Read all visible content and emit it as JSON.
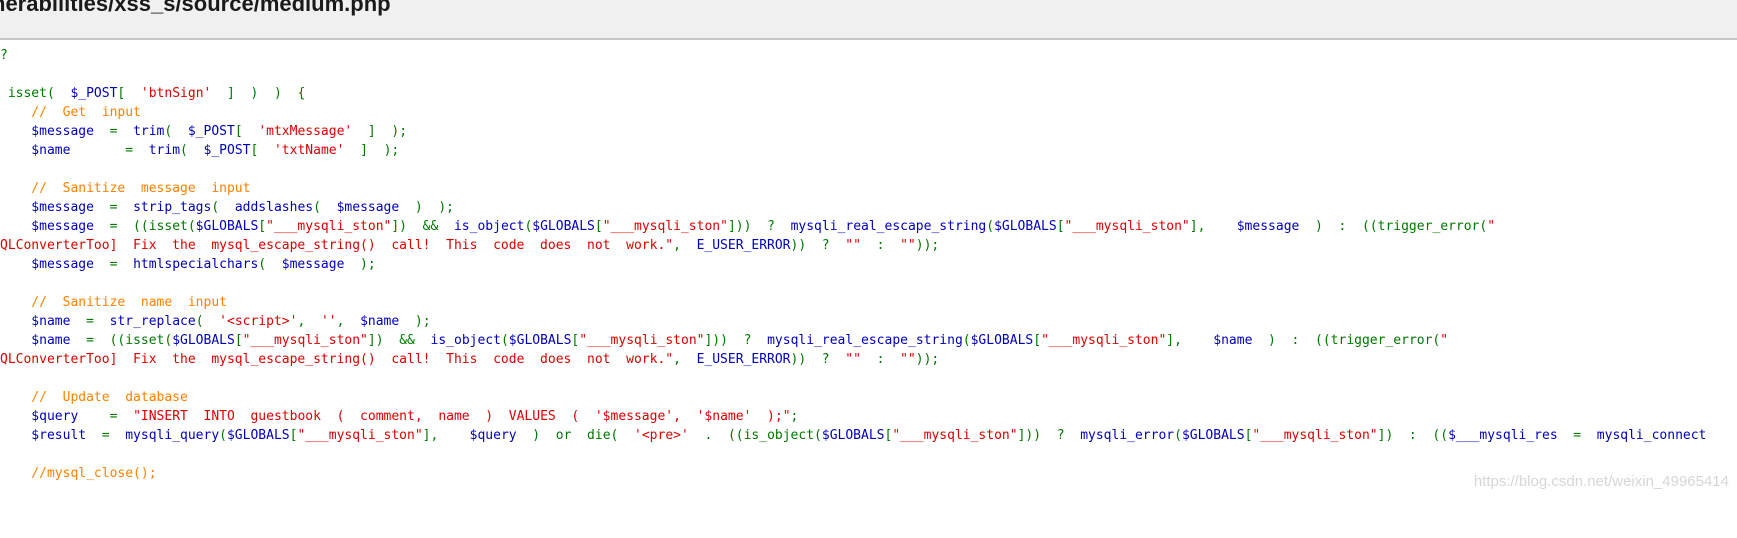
{
  "title": "nerabilities/xss_s/source/medium.php",
  "colors": {
    "default": "#0000BB",
    "keyword": "#007700",
    "string": "#DD0000",
    "comment": "#FF8000"
  },
  "code_lines": [
    [
      [
        "keyword",
        "?"
      ]
    ],
    [],
    [
      [
        "keyword",
        " isset(  "
      ],
      [
        "default",
        "$_POST"
      ],
      [
        "keyword",
        "[  "
      ],
      [
        "string",
        "'btnSign'"
      ],
      [
        "keyword",
        "  ]  )  )  {"
      ]
    ],
    [
      [
        "comment",
        "    //  Get  input"
      ]
    ],
    [
      [
        "default",
        "    $message"
      ],
      [
        "keyword",
        "  =  "
      ],
      [
        "default",
        "trim"
      ],
      [
        "keyword",
        "(  "
      ],
      [
        "default",
        "$_POST"
      ],
      [
        "keyword",
        "[  "
      ],
      [
        "string",
        "'mtxMessage'"
      ],
      [
        "keyword",
        "  ]  );"
      ]
    ],
    [
      [
        "default",
        "    $name"
      ],
      [
        "keyword",
        "       =  "
      ],
      [
        "default",
        "trim"
      ],
      [
        "keyword",
        "(  "
      ],
      [
        "default",
        "$_POST"
      ],
      [
        "keyword",
        "[  "
      ],
      [
        "string",
        "'txtName'"
      ],
      [
        "keyword",
        "  ]  );"
      ]
    ],
    [],
    [
      [
        "comment",
        "    //  Sanitize  message  input"
      ]
    ],
    [
      [
        "default",
        "    $message"
      ],
      [
        "keyword",
        "  =  "
      ],
      [
        "default",
        "strip_tags"
      ],
      [
        "keyword",
        "(  "
      ],
      [
        "default",
        "addslashes"
      ],
      [
        "keyword",
        "(  "
      ],
      [
        "default",
        "$message"
      ],
      [
        "keyword",
        "  )  );"
      ]
    ],
    [
      [
        "default",
        "    $message"
      ],
      [
        "keyword",
        "  =  ((isset("
      ],
      [
        "default",
        "$GLOBALS"
      ],
      [
        "keyword",
        "["
      ],
      [
        "string",
        "\"___mysqli_ston\""
      ],
      [
        "keyword",
        "])  &&  "
      ],
      [
        "default",
        "is_object"
      ],
      [
        "keyword",
        "("
      ],
      [
        "default",
        "$GLOBALS"
      ],
      [
        "keyword",
        "["
      ],
      [
        "string",
        "\"___mysqli_ston\""
      ],
      [
        "keyword",
        "]))  ?  "
      ],
      [
        "default",
        "mysqli_real_escape_string"
      ],
      [
        "keyword",
        "("
      ],
      [
        "default",
        "$GLOBALS"
      ],
      [
        "keyword",
        "["
      ],
      [
        "string",
        "\"___mysqli_ston\""
      ],
      [
        "keyword",
        "],    "
      ],
      [
        "default",
        "$message"
      ],
      [
        "keyword",
        "  )  :  ((trigger_error("
      ],
      [
        "string",
        "\""
      ]
    ],
    [
      [
        "string",
        "QLConverterToo]  Fix  the  mysql_escape_string()  call!  This  code  does  not  work.\""
      ],
      [
        "keyword",
        ",  "
      ],
      [
        "default",
        "E_USER_ERROR"
      ],
      [
        "keyword",
        "))  ?  "
      ],
      [
        "string",
        "\"\""
      ],
      [
        "keyword",
        "  :  "
      ],
      [
        "string",
        "\"\""
      ],
      [
        "keyword",
        "));"
      ]
    ],
    [
      [
        "default",
        "    $message"
      ],
      [
        "keyword",
        "  =  "
      ],
      [
        "default",
        "htmlspecialchars"
      ],
      [
        "keyword",
        "(  "
      ],
      [
        "default",
        "$message"
      ],
      [
        "keyword",
        "  );"
      ]
    ],
    [],
    [
      [
        "comment",
        "    //  Sanitize  name  input"
      ]
    ],
    [
      [
        "default",
        "    $name"
      ],
      [
        "keyword",
        "  =  "
      ],
      [
        "default",
        "str_replace"
      ],
      [
        "keyword",
        "(  "
      ],
      [
        "string",
        "'<script>'"
      ],
      [
        "keyword",
        ",  "
      ],
      [
        "string",
        "''"
      ],
      [
        "keyword",
        ",  "
      ],
      [
        "default",
        "$name"
      ],
      [
        "keyword",
        "  );"
      ]
    ],
    [
      [
        "default",
        "    $name"
      ],
      [
        "keyword",
        "  =  ((isset("
      ],
      [
        "default",
        "$GLOBALS"
      ],
      [
        "keyword",
        "["
      ],
      [
        "string",
        "\"___mysqli_ston\""
      ],
      [
        "keyword",
        "])  &&  "
      ],
      [
        "default",
        "is_object"
      ],
      [
        "keyword",
        "("
      ],
      [
        "default",
        "$GLOBALS"
      ],
      [
        "keyword",
        "["
      ],
      [
        "string",
        "\"___mysqli_ston\""
      ],
      [
        "keyword",
        "]))  ?  "
      ],
      [
        "default",
        "mysqli_real_escape_string"
      ],
      [
        "keyword",
        "("
      ],
      [
        "default",
        "$GLOBALS"
      ],
      [
        "keyword",
        "["
      ],
      [
        "string",
        "\"___mysqli_ston\""
      ],
      [
        "keyword",
        "],    "
      ],
      [
        "default",
        "$name"
      ],
      [
        "keyword",
        "  )  :  ((trigger_error("
      ],
      [
        "string",
        "\""
      ]
    ],
    [
      [
        "string",
        "QLConverterToo]  Fix  the  mysql_escape_string()  call!  This  code  does  not  work.\""
      ],
      [
        "keyword",
        ",  "
      ],
      [
        "default",
        "E_USER_ERROR"
      ],
      [
        "keyword",
        "))  ?  "
      ],
      [
        "string",
        "\"\""
      ],
      [
        "keyword",
        "  :  "
      ],
      [
        "string",
        "\"\""
      ],
      [
        "keyword",
        "));"
      ]
    ],
    [],
    [
      [
        "comment",
        "    //  Update  database"
      ]
    ],
    [
      [
        "default",
        "    $query"
      ],
      [
        "keyword",
        "    =  "
      ],
      [
        "string",
        "\"INSERT  INTO  guestbook  (  comment,  name  )  VALUES  (  '$message',  '$name'  );\""
      ],
      [
        "keyword",
        ";"
      ]
    ],
    [
      [
        "default",
        "    $result"
      ],
      [
        "keyword",
        "  =  "
      ],
      [
        "default",
        "mysqli_query"
      ],
      [
        "keyword",
        "("
      ],
      [
        "default",
        "$GLOBALS"
      ],
      [
        "keyword",
        "["
      ],
      [
        "string",
        "\"___mysqli_ston\""
      ],
      [
        "keyword",
        "],    "
      ],
      [
        "default",
        "$query"
      ],
      [
        "keyword",
        "  )  or  die(  "
      ],
      [
        "string",
        "'<pre>'"
      ],
      [
        "keyword",
        "  .  ((is_object("
      ],
      [
        "default",
        "$GLOBALS"
      ],
      [
        "keyword",
        "["
      ],
      [
        "string",
        "\"___mysqli_ston\""
      ],
      [
        "keyword",
        "]))  ?  "
      ],
      [
        "default",
        "mysqli_error"
      ],
      [
        "keyword",
        "("
      ],
      [
        "default",
        "$GLOBALS"
      ],
      [
        "keyword",
        "["
      ],
      [
        "string",
        "\"___mysqli_ston\""
      ],
      [
        "keyword",
        "])  :  (("
      ],
      [
        "default",
        "$___mysqli_res"
      ],
      [
        "keyword",
        "  =  "
      ],
      [
        "default",
        "mysqli_connect"
      ]
    ],
    [],
    [
      [
        "comment",
        "    //mysql_close();"
      ]
    ]
  ],
  "watermark": "https://blog.csdn.net/weixin_49965414"
}
